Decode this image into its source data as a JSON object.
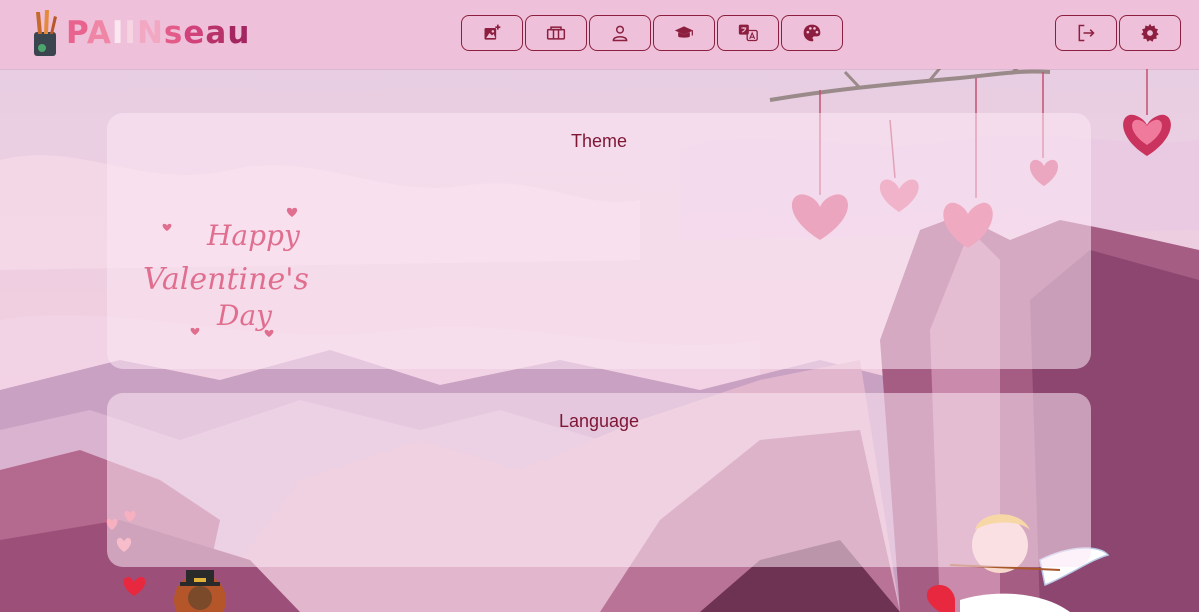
{
  "app": {
    "logo_letters": [
      "P",
      "A",
      "I",
      "I",
      "N",
      "s",
      "e",
      "a",
      "u"
    ]
  },
  "nav": {
    "buttons": [
      {
        "icon": "add-image-icon"
      },
      {
        "icon": "gallery-icon"
      },
      {
        "icon": "user-icon"
      },
      {
        "icon": "graduation-cap-icon"
      },
      {
        "icon": "translate-icon"
      },
      {
        "icon": "palette-icon"
      }
    ],
    "right_buttons": [
      {
        "icon": "logout-icon"
      },
      {
        "icon": "settings-icon"
      }
    ]
  },
  "sections": {
    "theme": {
      "title": "Theme",
      "selected_theme_art": "Happy Valentine's Day"
    },
    "language": {
      "title": "Language"
    }
  },
  "colors": {
    "accent": "#8c1f3f",
    "topbar": "#efc0da",
    "heading": "#7e1634"
  }
}
